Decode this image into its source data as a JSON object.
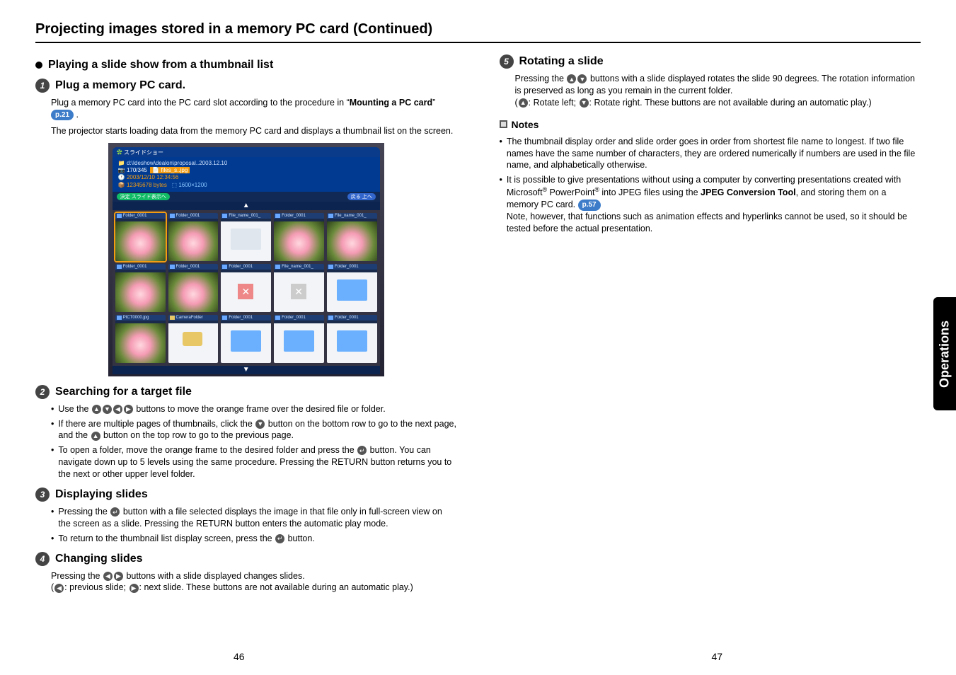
{
  "page_title": "Projecting images stored in a memory PC card (Continued)",
  "side_tab": "Operations",
  "page_left": "46",
  "page_right": "47",
  "left": {
    "section_a": "Playing a slide show from a thumbnail list",
    "step1": {
      "num": "1",
      "title": "Plug a memory PC card.",
      "body_a": "Plug a memory PC card into the PC card slot according to the procedure in “",
      "body_bold": "Mounting a PC card",
      "body_b": "” ",
      "ref": "p.21",
      "body_c": " .",
      "body2": "The projector starts loading data from the memory PC card and displays a thumbnail list on the screen."
    },
    "screenshot": {
      "window_title": "スライドショー",
      "path": "d:\\Ideshow\\dealon\\proposal..2003.12.10",
      "counter": "170/345",
      "selected_file": "files_s..jpg",
      "date": "2003/12/10 12:34:56",
      "size": "12345678 bytes",
      "dims": "1600×1200",
      "left_pill": "スライド表示へ",
      "right_pill": "上へ",
      "labels": {
        "folder": "Folder_0001",
        "file": "File_name_001_",
        "pict": "PICT0000.jpg",
        "camera": "CameraFolder"
      }
    },
    "step2": {
      "num": "2",
      "title": "Searching for a target file",
      "b1a": "Use the ",
      "b1b": " buttons to move the orange frame over the desired file or folder.",
      "b2a": "If there are multiple pages of thumbnails, click the ",
      "b2b": " button on the bottom row to go to the next page, and the ",
      "b2c": " button on the top row to go to the previous page.",
      "b3a": "To open a folder, move the orange frame to the desired folder and press the ",
      "b3b": " button. You can navigate down up to 5 levels using the same procedure. Pressing the RETURN button returns you to the next or other upper level folder."
    },
    "step3": {
      "num": "3",
      "title": "Displaying slides",
      "b1a": "Pressing the ",
      "b1b": " button with a file selected displays the image in that file only in full-screen view on the screen as a slide. Pressing the RETURN button enters the automatic play mode.",
      "b2a": "To return to the thumbnail list display screen, press the ",
      "b2b": " button."
    },
    "step4": {
      "num": "4",
      "title": "Changing slides",
      "body_a": "Pressing the ",
      "body_b": " buttons with a slide displayed changes slides.",
      "body_c": "(",
      "body_d": ": previous slide; ",
      "body_e": ": next slide. These buttons are not available during an automatic play.)"
    }
  },
  "right": {
    "step5": {
      "num": "5",
      "title": "Rotating a slide",
      "body_a": "Pressing the ",
      "body_b": " buttons with a slide displayed rotates the slide 90 degrees. The rotation information is preserved as long as you remain in the current folder.",
      "body_c": "(",
      "body_d": ": Rotate left; ",
      "body_e": ": Rotate right. These buttons are not available during an automatic play.)"
    },
    "notes_title": "Notes",
    "note1": "The thumbnail display order and slide order goes in order from shortest file name to longest. If two file names have the same number of characters, they are ordered numerically if numbers are used in the file name, and alphabetically otherwise.",
    "note2_a": "It is possible to give presentations without using a computer by converting presentations created with Microsoft",
    "note2_b": " PowerPoint",
    "note2_c": " into JPEG files using the ",
    "note2_bold": "JPEG Conversion Tool",
    "note2_d": ", and storing them on a memory PC card. ",
    "note2_ref": "p.57",
    "note2_e": "Note, however, that functions such as animation effects and hyperlinks cannot be used, so it should be tested before the actual presentation."
  },
  "icons": {
    "up": "▲",
    "down": "▼",
    "left": "◀",
    "right": "▶",
    "enter": "↵"
  }
}
